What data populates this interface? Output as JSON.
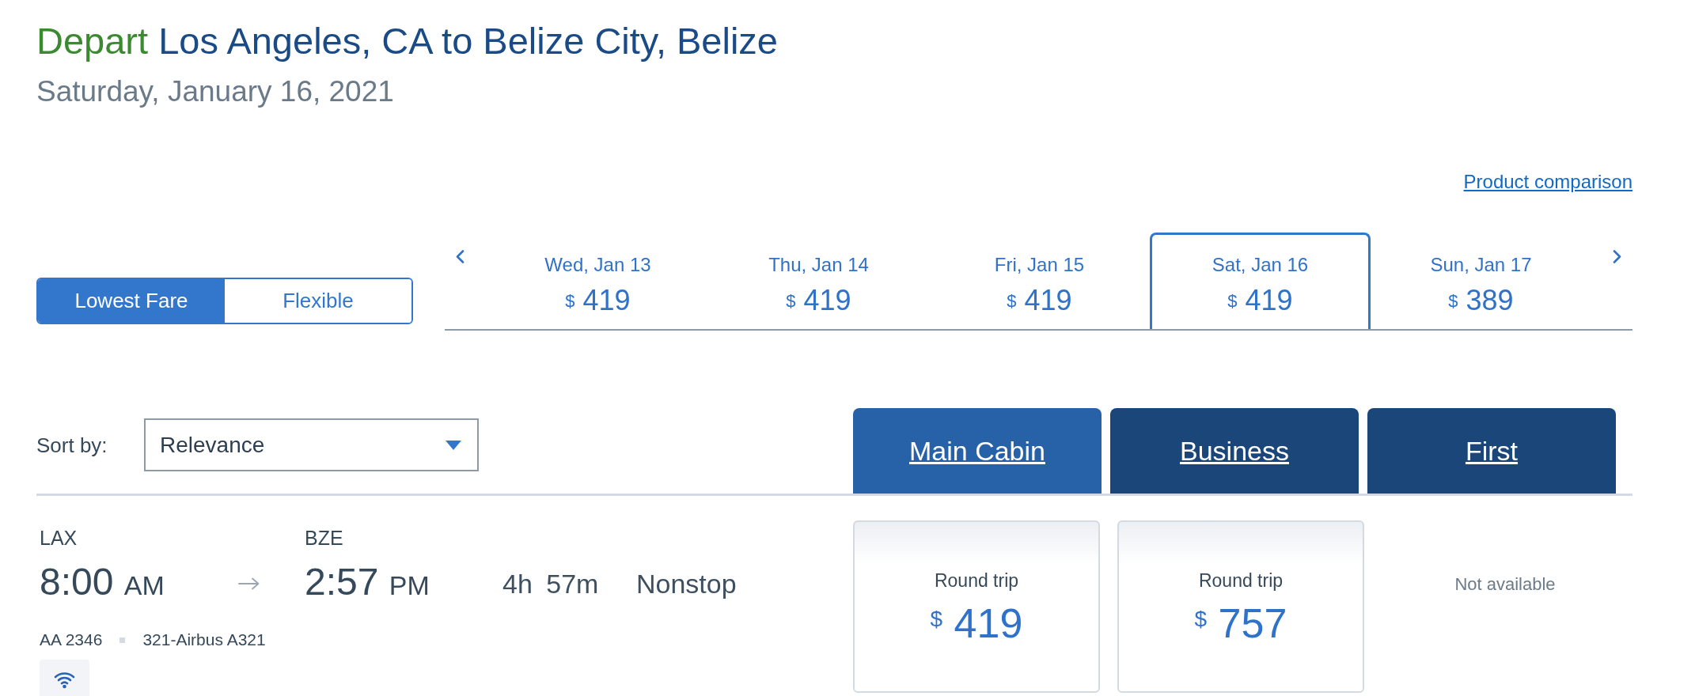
{
  "header": {
    "action": "Depart",
    "route": "Los Angeles, CA to Belize City, Belize",
    "date": "Saturday, January 16, 2021"
  },
  "product_comparison_link": "Product comparison",
  "fare_toggle": [
    {
      "label": "Lowest Fare",
      "selected": true
    },
    {
      "label": "Flexible",
      "selected": false
    }
  ],
  "date_tabs": [
    {
      "label": "Wed, Jan 13",
      "currency": "$",
      "price": "419",
      "selected": false
    },
    {
      "label": "Thu, Jan 14",
      "currency": "$",
      "price": "419",
      "selected": false
    },
    {
      "label": "Fri, Jan 15",
      "currency": "$",
      "price": "419",
      "selected": false
    },
    {
      "label": "Sat, Jan 16",
      "currency": "$",
      "price": "419",
      "selected": true
    },
    {
      "label": "Sun, Jan 17",
      "currency": "$",
      "price": "389",
      "selected": false
    }
  ],
  "sort": {
    "label": "Sort by:",
    "value": "Relevance"
  },
  "cabin_tabs": [
    {
      "label": "Main Cabin",
      "selected": true
    },
    {
      "label": "Business",
      "selected": false
    },
    {
      "label": "First",
      "selected": false
    }
  ],
  "flights": [
    {
      "origin": "LAX",
      "depart_time": "8:00",
      "depart_period": "AM",
      "destination": "BZE",
      "arrive_time": "2:57",
      "arrive_period": "PM",
      "duration": "4h 57m",
      "stops": "Nonstop",
      "flight_number": "AA 2346",
      "aircraft": "321-Airbus A321",
      "wifi": true,
      "fares": [
        {
          "kind": "price",
          "note": "Round trip",
          "currency": "$",
          "price": "419"
        },
        {
          "kind": "price",
          "note": "Round trip",
          "currency": "$",
          "price": "757"
        },
        {
          "kind": "unavailable",
          "note": "Not available"
        }
      ]
    }
  ]
}
